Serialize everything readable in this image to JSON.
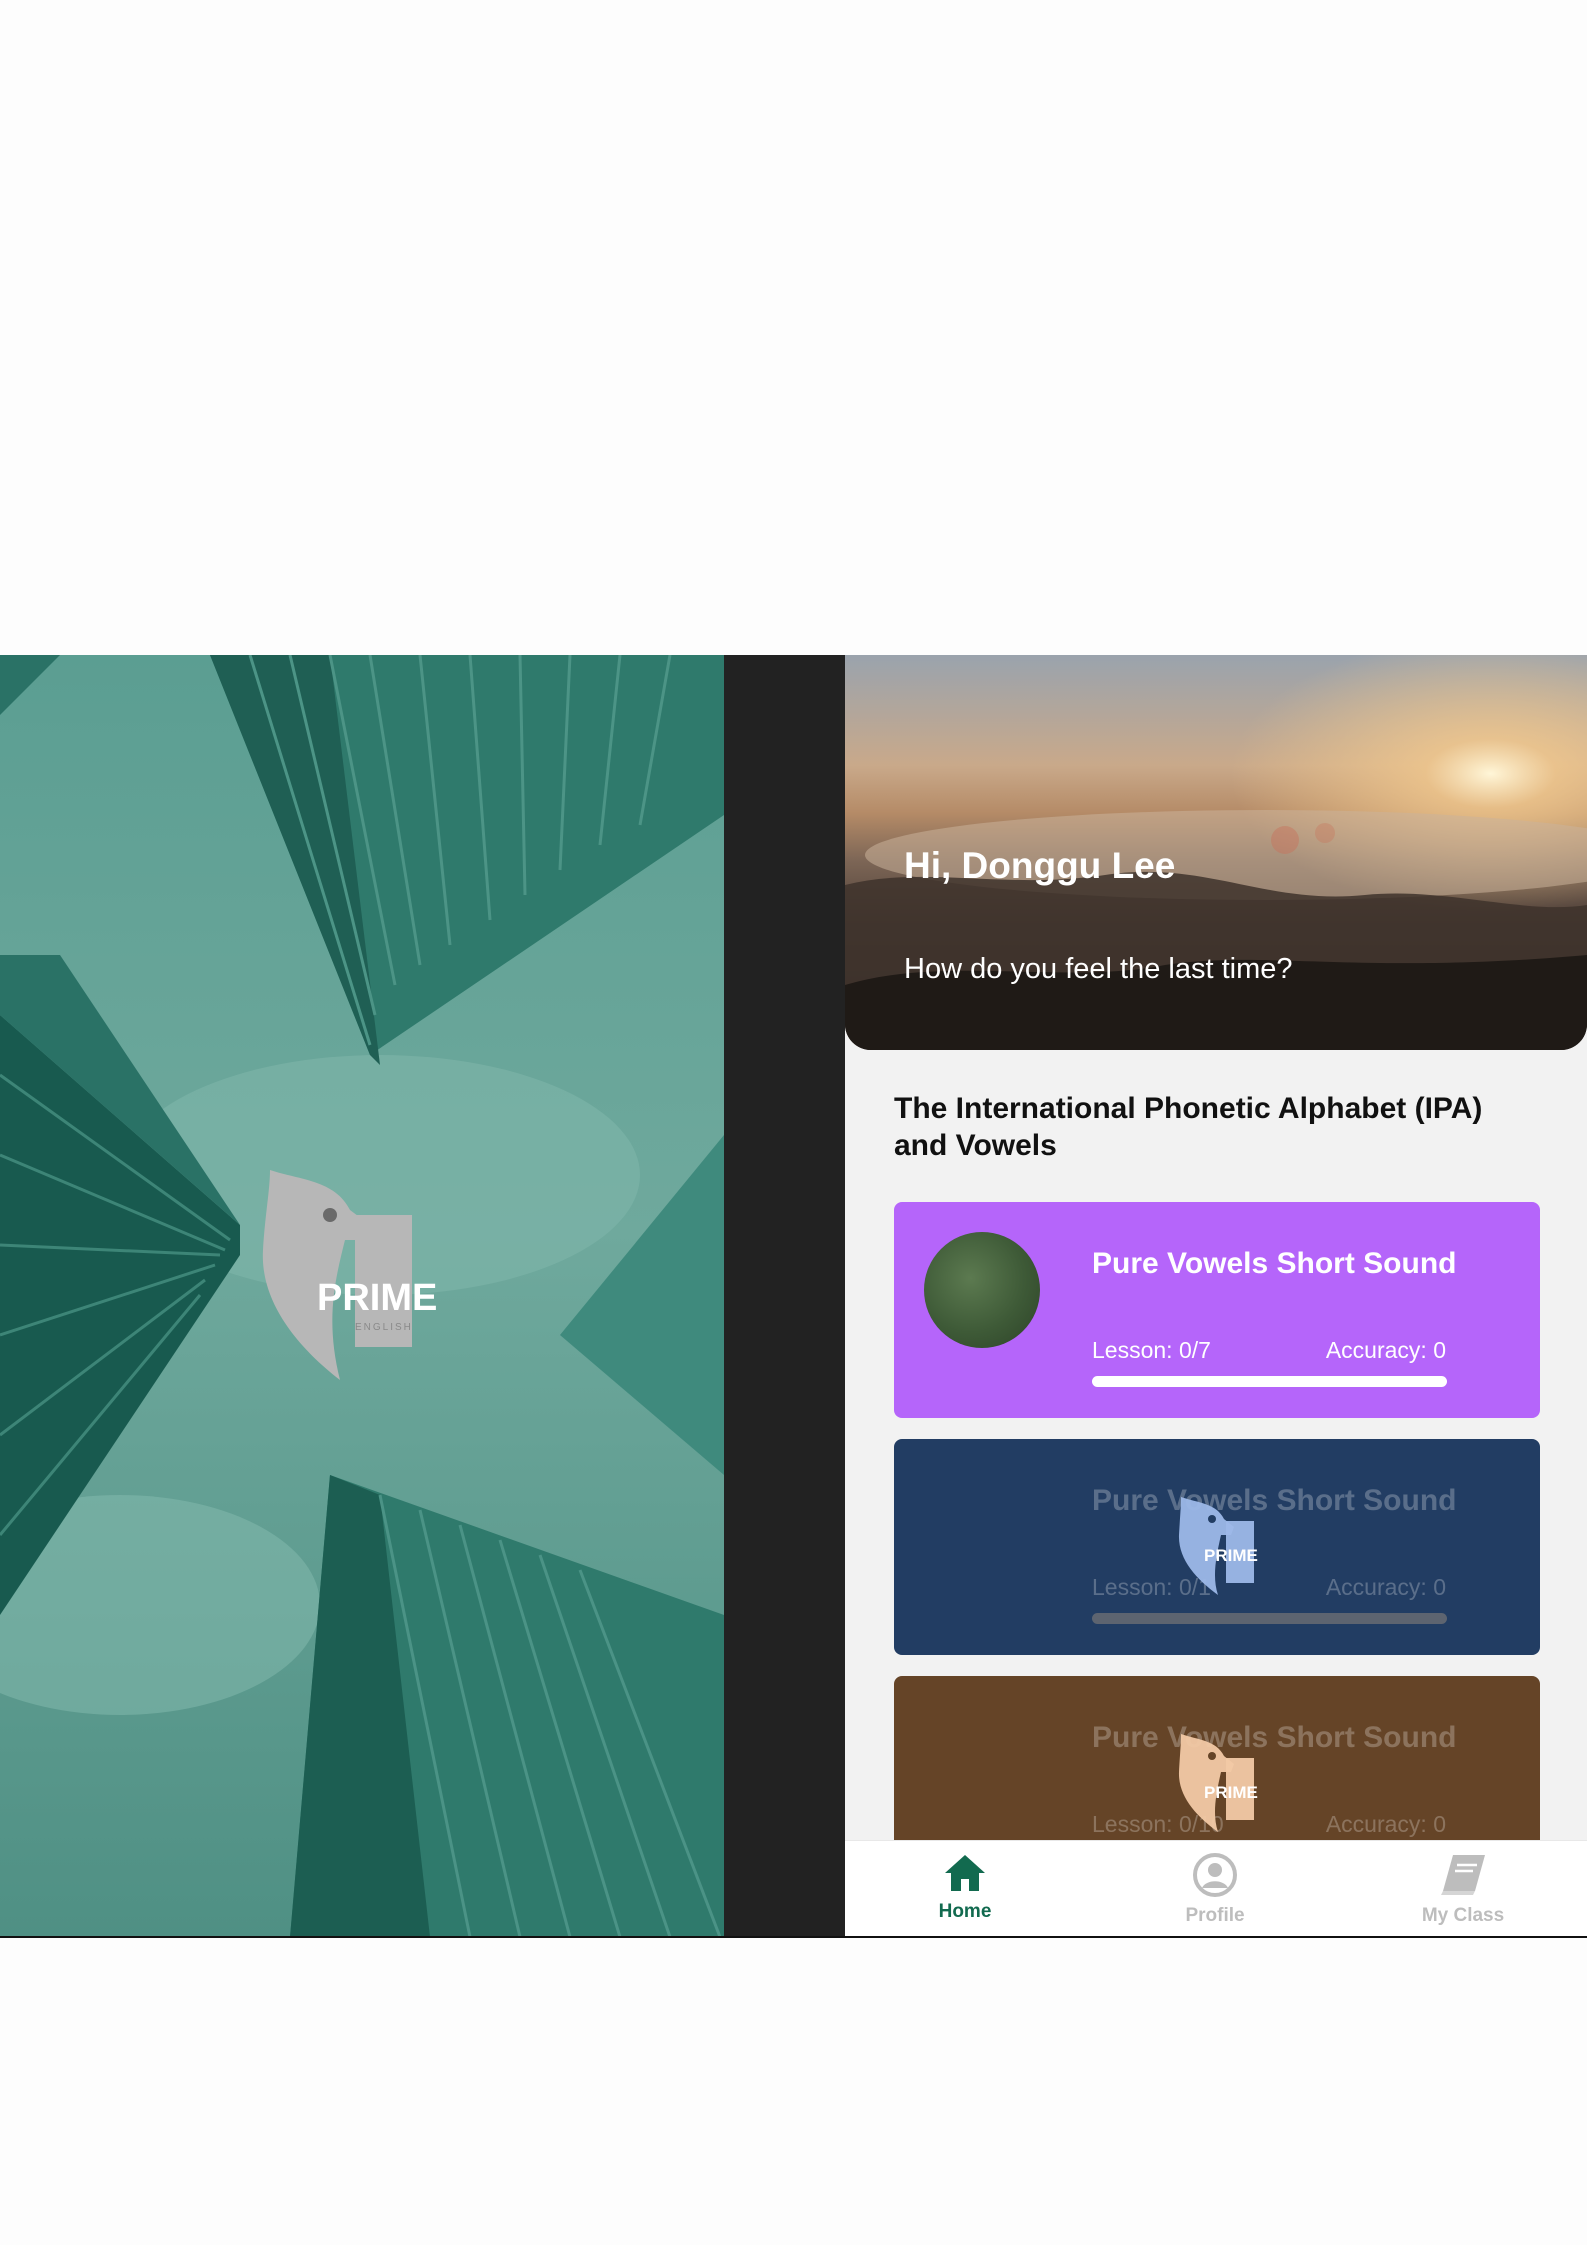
{
  "splash": {
    "logo_text": "PRIME",
    "logo_subtext": "ENGLISH",
    "bg_color": "#5b9e92"
  },
  "app": {
    "hero": {
      "greeting": "Hi, Donggu Lee",
      "subtitle": "How do you feel the last time?"
    },
    "section_title": "The International Phonetic Alphabet (IPA) and Vowels",
    "courses": [
      {
        "title": "Pure Vowels Short Sound",
        "lesson": "Lesson: 0/7",
        "accuracy": "Accuracy: 0",
        "color": "#b565fa",
        "locked": false,
        "progress": 1.0
      },
      {
        "title": "Pure Vowels Short Sound",
        "lesson": "Lesson: 0/1",
        "accuracy": "Accuracy: 0",
        "color": "#223d63",
        "locked": true,
        "progress": 1.0
      },
      {
        "title": "Pure Vowels Short Sound",
        "lesson": "Lesson: 0/10",
        "accuracy": "Accuracy: 0",
        "color": "#654427",
        "locked": true,
        "progress": 1.0
      }
    ],
    "lock_logo_text": "PRIME",
    "nav": {
      "home": {
        "label": "Home",
        "icon": "home-icon",
        "color": "#126a4f"
      },
      "profile": {
        "label": "Profile",
        "icon": "profile-icon",
        "color": "#bdbdbd"
      },
      "my_class": {
        "label": "My Class",
        "icon": "book-icon",
        "color": "#bdbdbd"
      }
    }
  }
}
